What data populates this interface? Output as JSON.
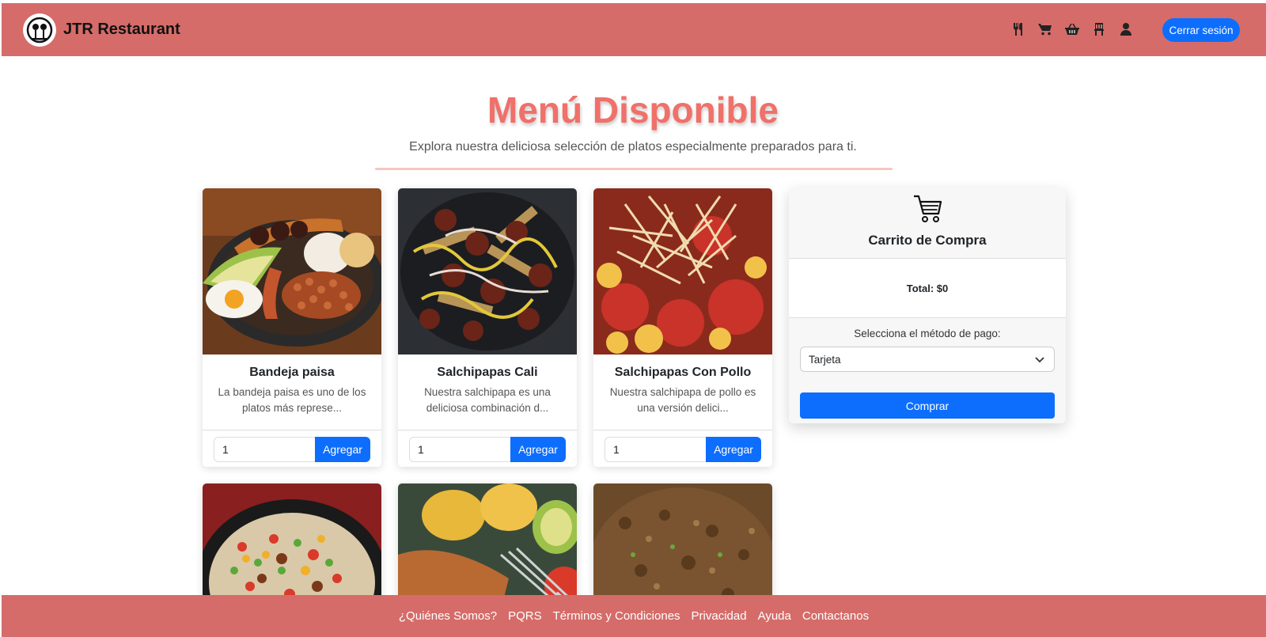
{
  "brand": {
    "name": "JTR Restaurant"
  },
  "nav": {
    "icons": [
      "utensils-icon",
      "cart-icon",
      "basket-icon",
      "chair-icon",
      "user-icon"
    ],
    "logout_label": "Cerrar sesión"
  },
  "heading": {
    "title": "Menú Disponible",
    "subtitle": "Explora nuestra deliciosa selección de platos especialmente preparados para ti."
  },
  "menu": {
    "items": [
      {
        "name": "Bandeja paisa",
        "desc_line1": "La bandeja paisa es uno de los",
        "desc_line2": "platos más represe...",
        "qty": "1",
        "add_label": "Agregar"
      },
      {
        "name": "Salchipapas Cali",
        "desc_line1": "Nuestra salchipapa es una",
        "desc_line2": "deliciosa combinación d...",
        "qty": "1",
        "add_label": "Agregar"
      },
      {
        "name": "Salchipapas Con Pollo",
        "desc_line1": "Nuestra salchipapa de pollo es",
        "desc_line2": "una versión delici...",
        "qty": "1",
        "add_label": "Agregar"
      }
    ]
  },
  "cart": {
    "title": "Carrito de Compra",
    "total": "Total: $0",
    "payment_label": "Selecciona el método de pago:",
    "payment_selected": "Tarjeta",
    "buy_label": "Comprar"
  },
  "footer": {
    "links": [
      "¿Quiénes Somos?",
      "PQRS",
      "Términos y Condiciones",
      "Privacidad",
      "Ayuda",
      "Contactanos"
    ]
  },
  "colors": {
    "brand": "#d56c69",
    "title": "#f0706a",
    "primary": "#0d6efd"
  }
}
